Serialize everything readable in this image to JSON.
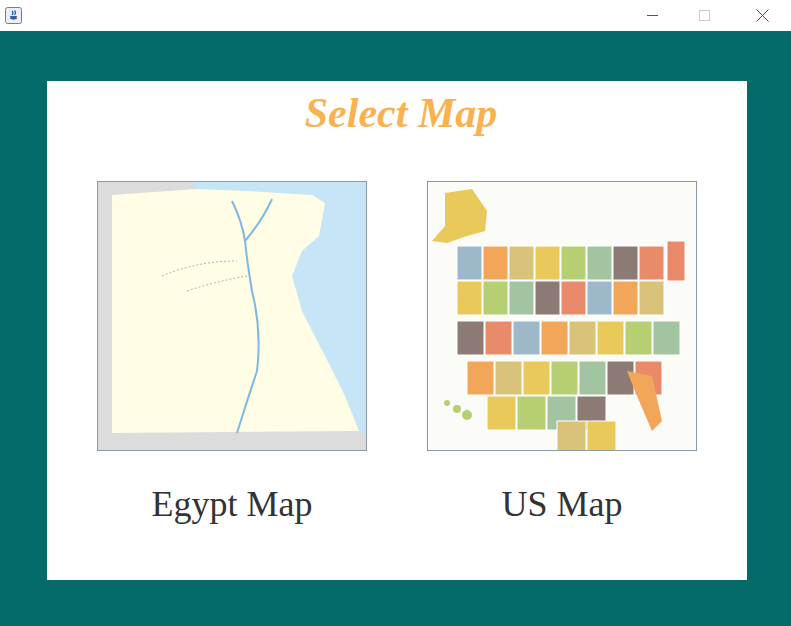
{
  "heading": "Select Map",
  "maps": [
    {
      "label": "Egypt Map",
      "kind": "egypt"
    },
    {
      "label": "US Map",
      "kind": "us"
    }
  ]
}
